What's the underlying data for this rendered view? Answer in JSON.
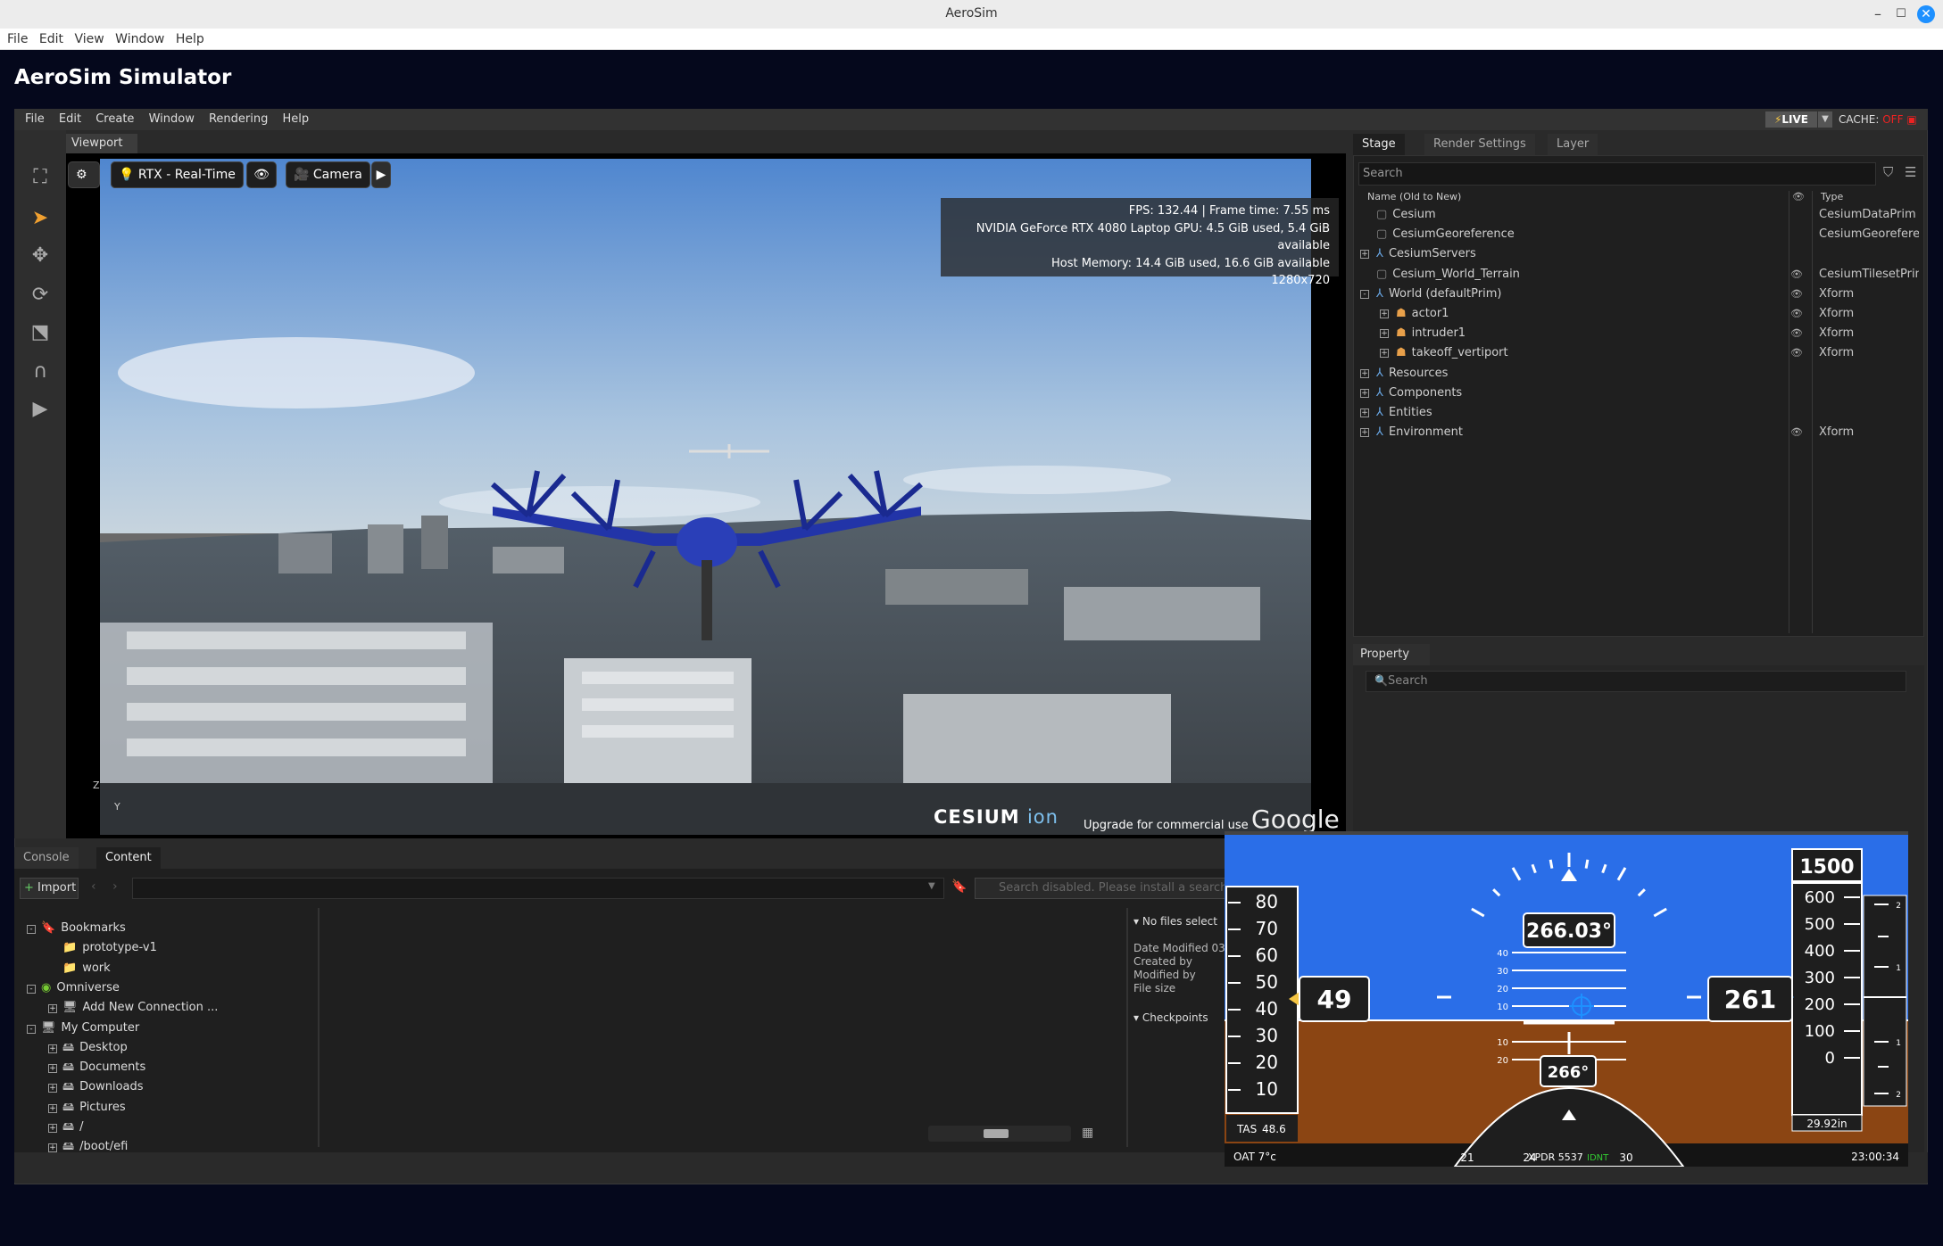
{
  "window": {
    "title": "AeroSim"
  },
  "os_menu": [
    "File",
    "Edit",
    "View",
    "Window",
    "Help"
  ],
  "app": {
    "title": "AeroSim Simulator"
  },
  "app_menu": [
    "File",
    "Edit",
    "Create",
    "Window",
    "Rendering",
    "Help"
  ],
  "live": {
    "label": "LIVE",
    "cache_label": "CACHE:",
    "cache_state": "OFF"
  },
  "viewport": {
    "tab": "Viewport",
    "render_mode": "RTX - Real-Time",
    "camera": "Camera",
    "stats": [
      "FPS: 132.44 | Frame time: 7.55 ms",
      "NVIDIA GeForce RTX 4080 Laptop GPU: 4.5 GiB used, 5.4 GiB available",
      "Host Memory: 14.4 GiB used, 16.6 GiB available",
      "1280x720"
    ],
    "cesium_logo": "CESIUM",
    "cesium_ion": "ion",
    "upgrade": "Upgrade for commercial use",
    "google": "Google",
    "axis_z": "Z",
    "axis_y": "Y"
  },
  "stage": {
    "tabs": [
      "Stage",
      "Render Settings",
      "Layer"
    ],
    "search_placeholder": "Search",
    "col_name": "Name (Old to New)",
    "col_type": "Type",
    "rows": [
      {
        "name": "Cesium",
        "type": "CesiumDataPrim",
        "eye": false
      },
      {
        "name": "CesiumGeoreference",
        "type": "CesiumGeoreference",
        "eye": false
      },
      {
        "name": "CesiumServers",
        "type": "",
        "eye": false
      },
      {
        "name": "Cesium_World_Terrain",
        "type": "CesiumTilesetPrim",
        "eye": true
      },
      {
        "name": "World (defaultPrim)",
        "type": "Xform",
        "eye": true
      },
      {
        "name": "actor1",
        "type": "Xform",
        "eye": true
      },
      {
        "name": "intruder1",
        "type": "Xform",
        "eye": true
      },
      {
        "name": "takeoff_vertiport",
        "type": "Xform",
        "eye": true
      },
      {
        "name": "Resources",
        "type": "",
        "eye": false
      },
      {
        "name": "Components",
        "type": "",
        "eye": false
      },
      {
        "name": "Entities",
        "type": "",
        "eye": false
      },
      {
        "name": "Environment",
        "type": "Xform",
        "eye": true
      }
    ]
  },
  "property": {
    "tab": "Property",
    "search_placeholder": "Search"
  },
  "bottom": {
    "tabs": [
      "Console",
      "Content"
    ],
    "import": "Import",
    "search_placeholder": "Search disabled. Please install a search",
    "tree": [
      {
        "label": "Bookmarks",
        "depth": 0
      },
      {
        "label": "prototype-v1",
        "depth": 1
      },
      {
        "label": "work",
        "depth": 1
      },
      {
        "label": "Omniverse",
        "depth": 0
      },
      {
        "label": "Add New Connection ...",
        "depth": 1
      },
      {
        "label": "My Computer",
        "depth": 0
      },
      {
        "label": "Desktop",
        "depth": 1
      },
      {
        "label": "Documents",
        "depth": 1
      },
      {
        "label": "Downloads",
        "depth": 1
      },
      {
        "label": "Pictures",
        "depth": 1
      },
      {
        "label": "/",
        "depth": 1
      },
      {
        "label": "/boot/efi",
        "depth": 1
      }
    ],
    "detail": {
      "header": "No files select",
      "fields": [
        "Date Modified 03.",
        "Created by",
        "Modified by",
        "File size"
      ],
      "checkpoints": "Checkpoints"
    }
  },
  "pfd": {
    "speed_ticks": [
      80,
      70,
      60,
      50,
      40,
      30,
      20,
      10
    ],
    "airspeed": "49",
    "tas_label": "TAS",
    "tas": "48.6",
    "oat": "OAT 7°c",
    "heading_bug": "266.03°",
    "heading": "266°",
    "pitch_marks": [
      40,
      30,
      20,
      10,
      10,
      20
    ],
    "target_alt": "1500",
    "alt_ticks": [
      600,
      500,
      400,
      300,
      200,
      100,
      0
    ],
    "altitude": "261",
    "baro": "29.92in",
    "vs_marks": [
      "2",
      "1",
      "1",
      "2"
    ],
    "compass": [
      "21",
      "24",
      "30"
    ],
    "xpdr": "XPDR 5537",
    "ident": "IDNT",
    "time": "23:00:34",
    "colors": {
      "sky": "#2a6ee8",
      "ground": "#8b4513",
      "bug": "#1e90ff",
      "marker": "#f5c542"
    }
  }
}
